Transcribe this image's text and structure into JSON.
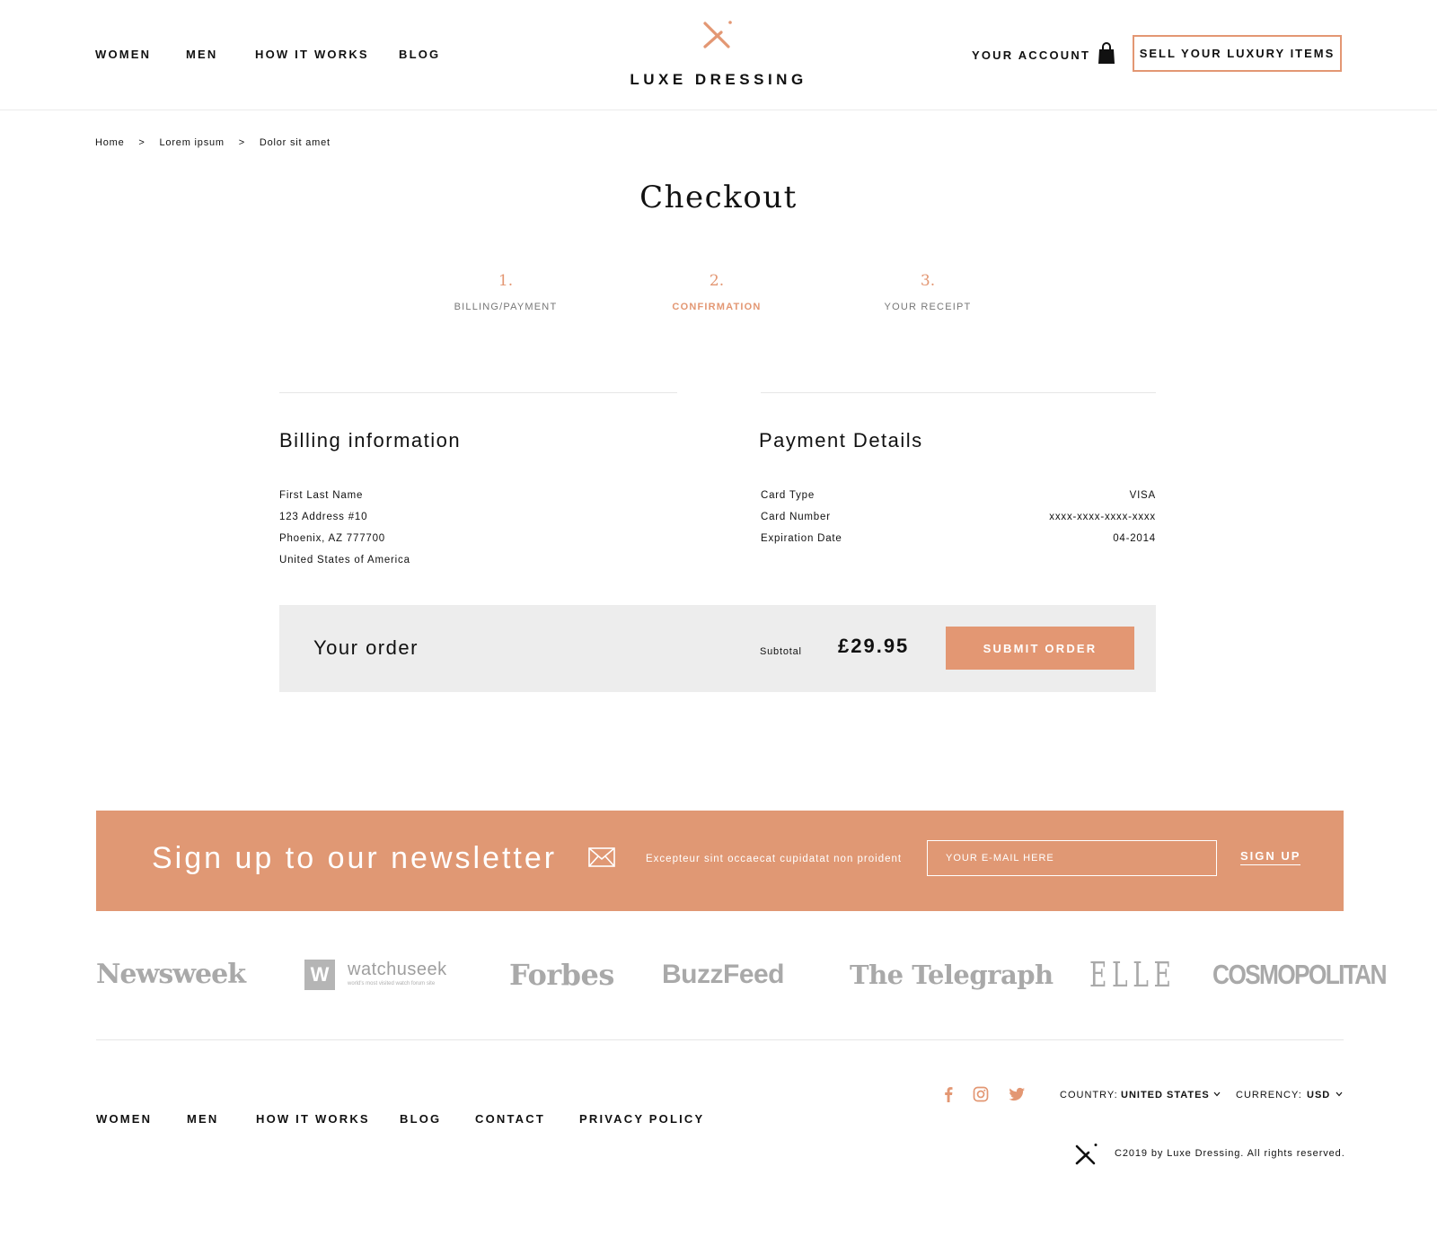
{
  "header": {
    "nav": [
      "WOMEN",
      "MEN",
      "HOW IT WORKS",
      "BLOG"
    ],
    "logo_text": "LUXE DRESSING",
    "account_label": "YOUR ACCOUNT",
    "sell_label": "SELL YOUR LUXURY ITEMS"
  },
  "breadcrumb": {
    "items": [
      "Home",
      "Lorem ipsum",
      "Dolor sit amet"
    ],
    "separator": ">"
  },
  "page_title": "Checkout",
  "steps": [
    {
      "number": "1.",
      "label": "BILLING/PAYMENT",
      "active": false
    },
    {
      "number": "2.",
      "label": "CONFIRMATION",
      "active": true
    },
    {
      "number": "3.",
      "label": "YOUR RECEIPT",
      "active": false
    }
  ],
  "billing": {
    "title": "Billing information",
    "lines": [
      "First Last Name",
      "123 Address #10",
      "Phoenix, AZ 777700",
      "United States of America"
    ]
  },
  "payment": {
    "title": "Payment Details",
    "rows": [
      {
        "label": "Card Type",
        "value": "VISA"
      },
      {
        "label": "Card Number",
        "value": "xxxx-xxxx-xxxx-xxxx"
      },
      {
        "label": "Expiration Date",
        "value": "04-2014"
      }
    ]
  },
  "order": {
    "title": "Your order",
    "subtotal_label": "Subtotal",
    "subtotal_value": "£29.95",
    "submit_label": "SUBMIT ORDER"
  },
  "newsletter": {
    "title": "Sign up to our newsletter",
    "text": "Excepteur sint occaecat cupidatat non proident",
    "placeholder": "YOUR E-MAIL HERE",
    "signup_label": "SIGN UP",
    "icon": "envelope-icon"
  },
  "press": {
    "newsweek": "Newsweek",
    "watchuseek": "watchuseek",
    "watchuseek_mark": "W",
    "watchuseek_tagline": "world's most visited watch forum site",
    "forbes": "Forbes",
    "buzzfeed": "BuzzFeed",
    "telegraph": "The Telegraph",
    "elle": "ELLE",
    "cosmopolitan": "COSMOPOLITAN"
  },
  "footer": {
    "nav": [
      "WOMEN",
      "MEN",
      "HOW IT WORKS",
      "BLOG",
      "CONTACT",
      "PRIVACY POLICY"
    ],
    "social_icons": [
      "facebook-icon",
      "instagram-icon",
      "twitter-icon"
    ],
    "country_label": "COUNTRY:",
    "country_value": "UNITED STATES",
    "currency_label": "CURRENCY:",
    "currency_value": "USD",
    "copyright": "C2019 by Luxe Dressing. All rights reserved."
  },
  "colors": {
    "accent": "#e39773",
    "newsletter_bg": "#e09874",
    "order_bg": "#ededed",
    "press_gray": "#a9a9a9"
  }
}
